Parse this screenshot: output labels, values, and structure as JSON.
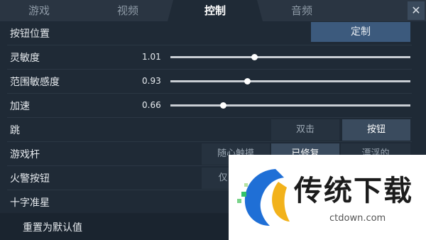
{
  "tabs": [
    {
      "label": "游戏",
      "active": false
    },
    {
      "label": "视频",
      "active": false
    },
    {
      "label": "控制",
      "active": true
    },
    {
      "label": "音频",
      "active": false
    }
  ],
  "close_label": "✕",
  "settings": {
    "button_position": {
      "label": "按钮位置",
      "button": "定制"
    },
    "sensitivity": {
      "label": "灵敏度",
      "value": "1.01",
      "level": 0.35
    },
    "scope_sensitivity": {
      "label": "范围敏感度",
      "value": "0.93",
      "level": 0.32
    },
    "acceleration": {
      "label": "加速",
      "value": "0.66",
      "level": 0.22
    },
    "jump": {
      "label": "跳",
      "options": [
        "双击",
        "按钮"
      ],
      "selected": "按钮"
    },
    "joystick": {
      "label": "游戏杆",
      "options": [
        "随心触摸",
        "已修复",
        "漂浮的"
      ],
      "selected": "已修复"
    },
    "fire_button": {
      "label": "火警按钮",
      "partial_option": "仅"
    },
    "crosshair": {
      "label": "十字准星"
    }
  },
  "footer": {
    "reset_label": "重置为默认值"
  },
  "watermark": {
    "text": "传统下载",
    "url": "ctdown.com"
  },
  "colors": {
    "accent": "#3c5a7d",
    "background": "#1f2a36"
  }
}
